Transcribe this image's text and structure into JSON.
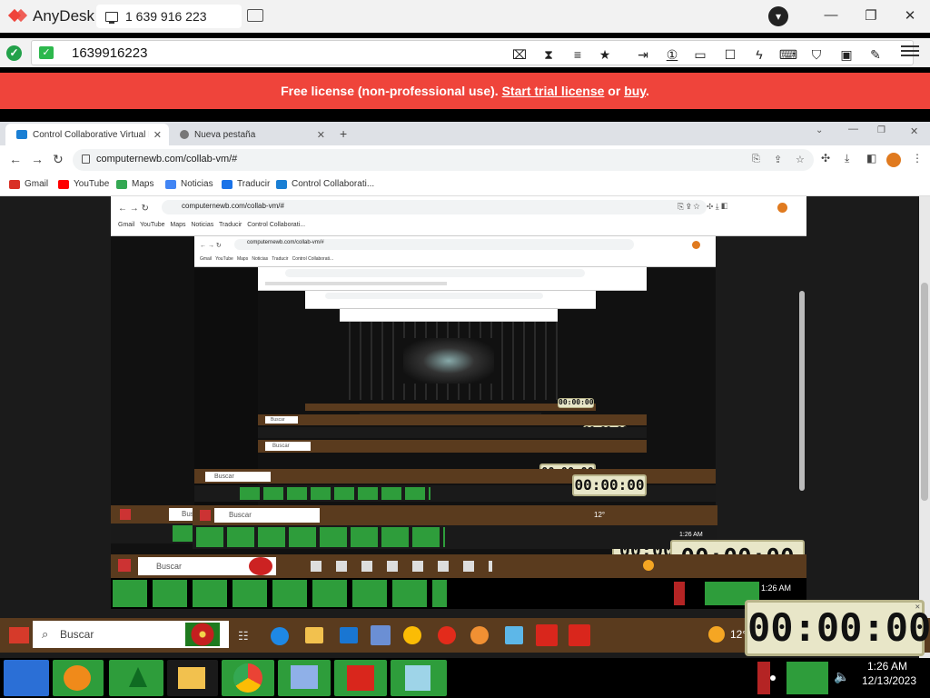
{
  "anydesk": {
    "app_name": "AnyDesk",
    "session_tab": "1 639 916 223",
    "address_value": "1639916223",
    "license_prefix": "Free license (non-professional use).",
    "license_trial": "Start trial license",
    "license_or": "or",
    "license_buy": "buy",
    "license_suffix": ".",
    "brand_color": "#ef443b"
  },
  "remote_browser": {
    "tabs": [
      {
        "title": "Control Collaborative Virtual Ma",
        "active": true
      },
      {
        "title": "Nueva pestaña",
        "active": false
      }
    ],
    "url": "computernewb.com/collab-vm/#",
    "bookmarks": [
      "Gmail",
      "YouTube",
      "Maps",
      "Noticias",
      "Traducir",
      "Control Collaborati..."
    ]
  },
  "nested": {
    "url": "computernewb.com/collab-vm/#",
    "bookmarks": [
      "Gmail",
      "YouTube",
      "Maps",
      "Noticias",
      "Traducir",
      "Control Collaborati..."
    ]
  },
  "taskbar": {
    "search_placeholder": "Buscar",
    "temperature": "12°",
    "time": "1:26 AM",
    "date": "12/13/2023",
    "stopwatch": "00:00:00"
  }
}
